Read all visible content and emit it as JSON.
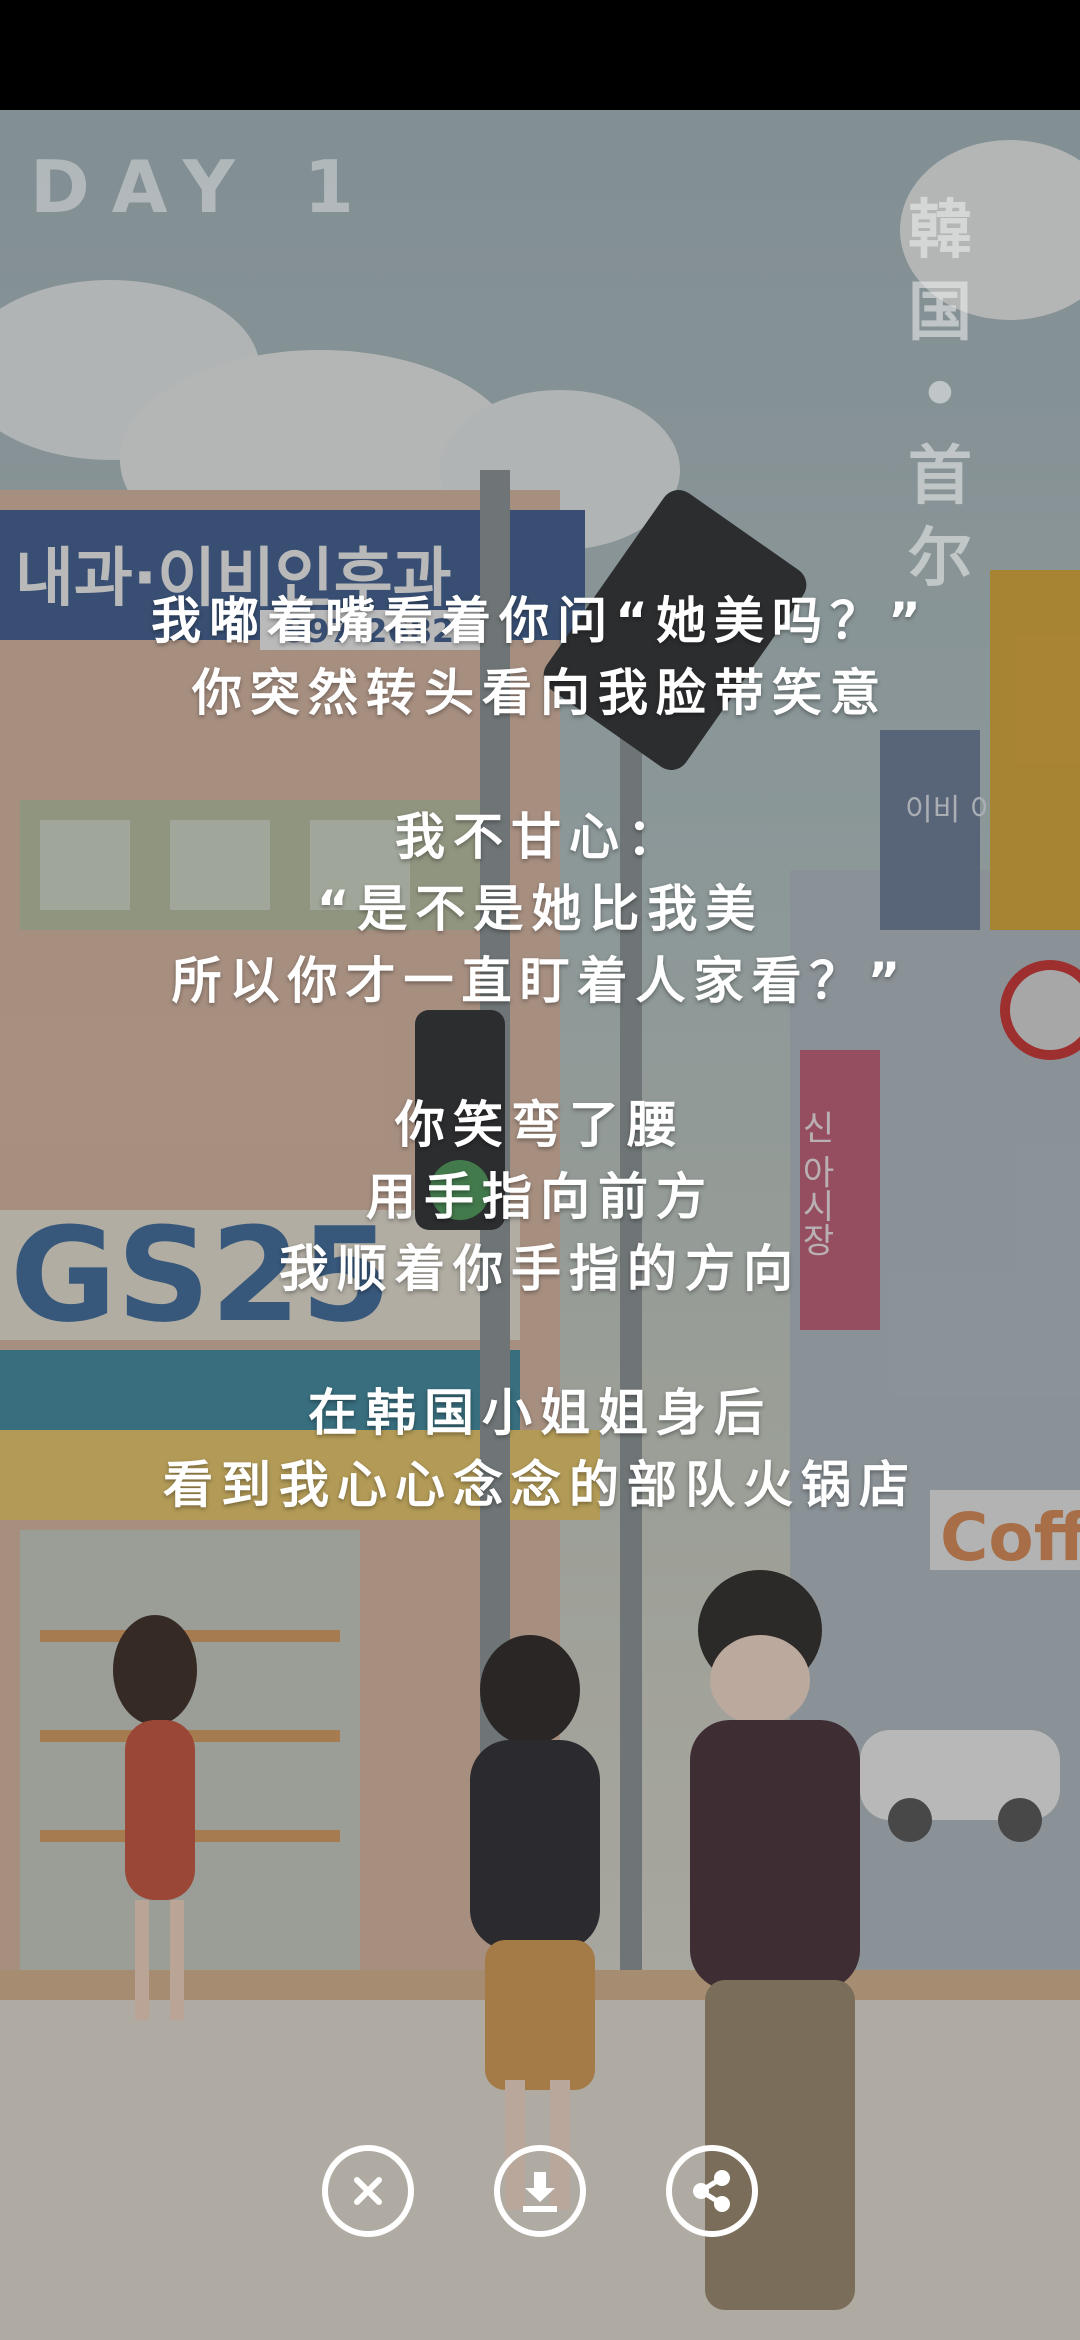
{
  "scene": {
    "day_label": "DAY 1",
    "vertical_title": [
      "韓",
      "国",
      "•",
      "首",
      "尔"
    ],
    "signs": {
      "clinic": "내과·이비인후과",
      "phone": "997-2682",
      "store": "GS25",
      "korean_vertical": "신 아시장",
      "cafe": "Coff",
      "side": "이비 이"
    }
  },
  "poem": {
    "stanzas": [
      [
        "我嘟着嘴看着你问“她美吗？”",
        "你突然转头看向我脸带笑意"
      ],
      [
        "我不甘心：",
        "“是不是她比我美",
        "所以你才一直盯着人家看？”"
      ],
      [
        "你笑弯了腰",
        "用手指向前方",
        "我顺着你手指的方向"
      ],
      [
        "在韩国小姐姐身后",
        "看到我心心念念的部队火锅店"
      ]
    ]
  },
  "actions": {
    "close": "close-icon",
    "download": "download-icon",
    "share": "share-icon"
  }
}
